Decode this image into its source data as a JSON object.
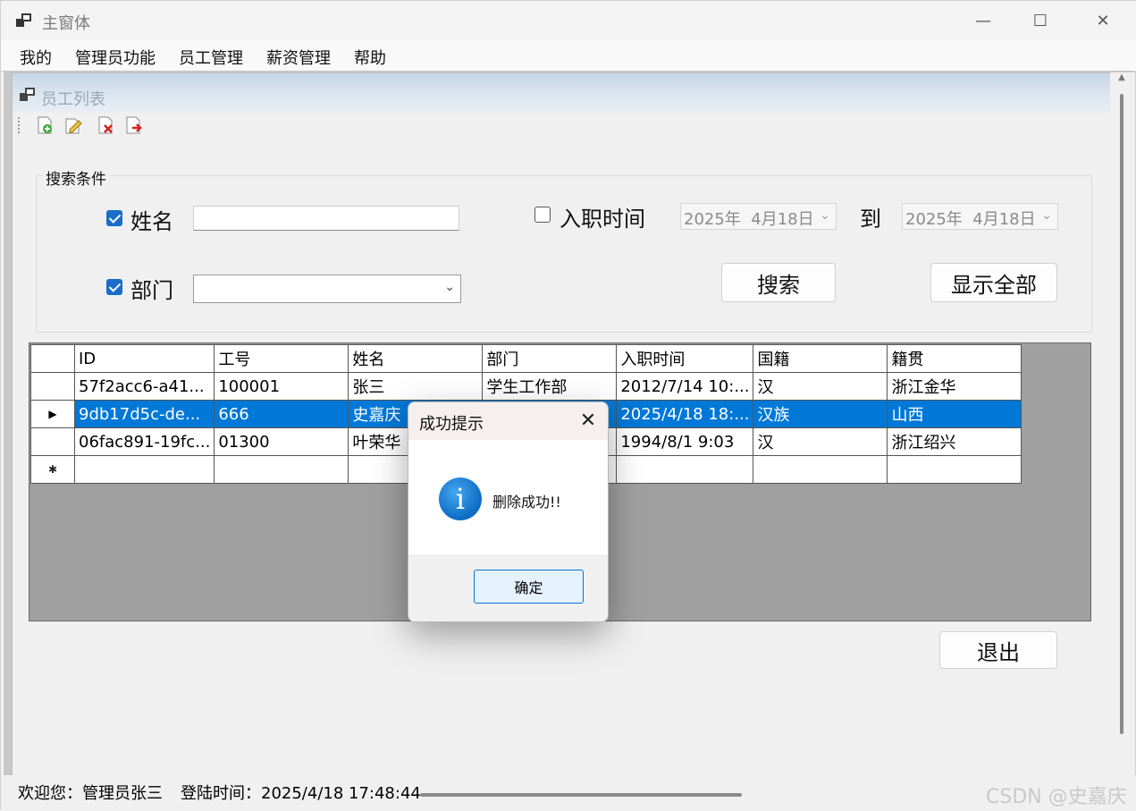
{
  "window": {
    "title": "主窗体",
    "min_symbol": "—",
    "max_symbol": "☐",
    "close_symbol": "✕"
  },
  "menu": [
    "我的",
    "管理员功能",
    "员工管理",
    "薪资管理",
    "帮助"
  ],
  "child": {
    "title": "员工列表"
  },
  "toolbar": {
    "icons": [
      "add-doc-icon",
      "edit-doc-icon",
      "delete-doc-icon",
      "export-doc-icon"
    ]
  },
  "search": {
    "group_label": "搜索条件",
    "name_label": "姓名",
    "name_checked": true,
    "name_value": "",
    "dept_label": "部门",
    "dept_checked": true,
    "dept_value": "",
    "date_label": "入职时间",
    "date_checked": false,
    "date_from": "2025年  4月18日",
    "to_label": "到",
    "date_to": "2025年  4月18日",
    "search_button": "搜索",
    "show_all_button": "显示全部"
  },
  "grid": {
    "columns": [
      "ID",
      "工号",
      "姓名",
      "部门",
      "入职时间",
      "国籍",
      "籍贯"
    ],
    "rows": [
      [
        "57f2acc6-a41...",
        "100001",
        "张三",
        "学生工作部",
        "2012/7/14 10:...",
        "汉",
        "浙江金华"
      ],
      [
        "9db17d5c-de...",
        "666",
        "史嘉庆",
        "",
        "2025/4/18 18:...",
        "汉族",
        "山西"
      ],
      [
        "06fac891-19fc...",
        "01300",
        "叶荣华",
        "",
        "1994/8/1 9:03",
        "汉",
        "浙江绍兴"
      ]
    ],
    "selected_row": 1,
    "current_row_marker": "▶",
    "new_row_marker": "✱"
  },
  "exit_button": "退出",
  "status": {
    "welcome": "欢迎您：管理员张三",
    "login_time": "登陆时间：2025/4/18 17:48:44"
  },
  "watermark": "CSDN @史嘉庆",
  "dialog": {
    "title": "成功提示",
    "close_symbol": "✕",
    "icon_glyph": "i",
    "message": "删除成功!!",
    "ok_button": "确定"
  },
  "colors": {
    "selection": "#0078d7",
    "checkbox": "#1a6dc9",
    "grid_bg": "#a0a0a0"
  }
}
